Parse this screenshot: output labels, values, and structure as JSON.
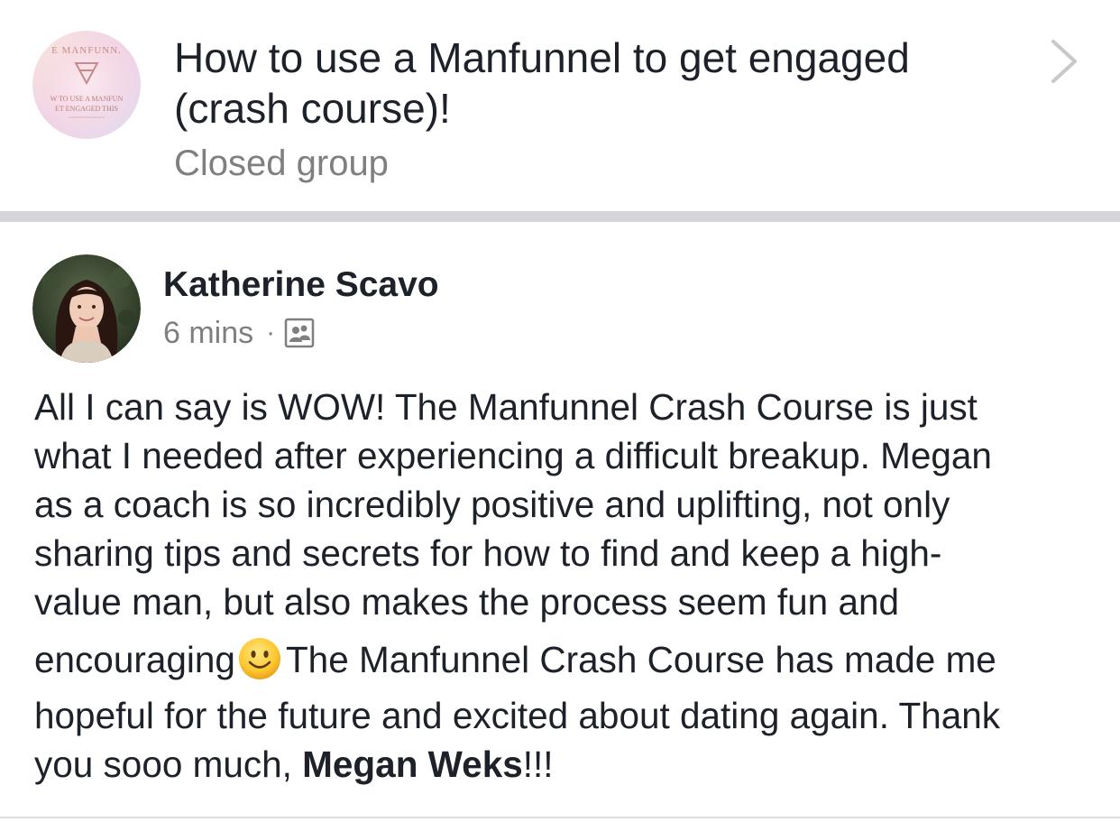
{
  "group": {
    "avatar_text_top": "E MANFUNN.",
    "avatar_text_line1": "W TO USE A MANFUN",
    "avatar_text_line2": "ET ENGAGED THIS",
    "title": "How to use a Manfunnel to get engaged (crash course)!",
    "type": "Closed group",
    "chevron_icon": "chevron-right-icon"
  },
  "post": {
    "author": "Katherine Scavo",
    "timestamp": "6 mins",
    "separator": "·",
    "audience_icon": "group-members-icon",
    "text_lines": [
      "All I can say is WOW! The Manfunnel Crash Course is just",
      "what I needed after experiencing a difficult breakup. Megan",
      "as a coach is so incredibly positive and uplifting, not only",
      "sharing tips and secrets for how to find and keep a high-",
      "value man, but also makes the process seem fun and"
    ],
    "line6_before_emoji": "encouraging",
    "emoji": "smiley-face-icon",
    "line6_after_emoji": "The Manfunnel Crash Course has made me",
    "line7": "hopeful for the future and excited about dating again. Thank",
    "line8_before_mention": "you sooo much, ",
    "mention": "Megan Weks",
    "line8_after_mention": "!!!"
  },
  "colors": {
    "text": "#1d2129",
    "secondary_text": "#7f7f7f",
    "separator": "#d3d5da",
    "chevron": "#c7c7cc"
  }
}
